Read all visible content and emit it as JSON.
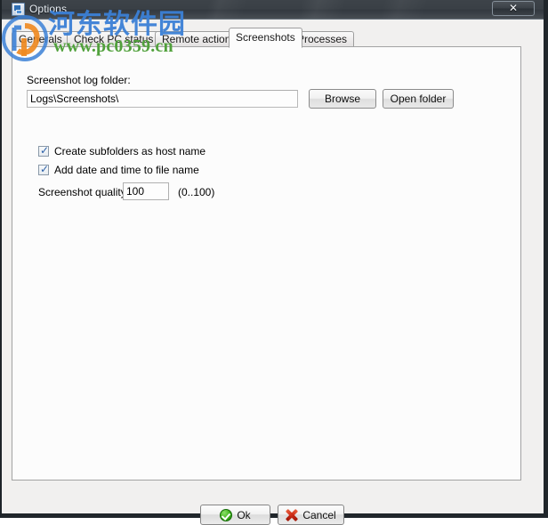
{
  "window": {
    "title": "Options",
    "icon": "application-icon",
    "close_label": "✕"
  },
  "tabs": [
    {
      "label": "Generals",
      "active": false
    },
    {
      "label": "Check PC status",
      "active": false
    },
    {
      "label": "Remote action",
      "active": false
    },
    {
      "label": "Screenshots",
      "active": true
    },
    {
      "label": "Processes",
      "active": false
    }
  ],
  "screenshots_tab": {
    "folder_label": "Screenshot log folder:",
    "folder_value": "Logs\\Screenshots\\",
    "folder_placeholder": "",
    "browse_label": "Browse",
    "open_folder_label": "Open folder",
    "checkbox_subfolders": {
      "label": "Create subfolders as host name",
      "checked": true,
      "mark": "✓"
    },
    "checkbox_datetime": {
      "label": "Add date and time to file name",
      "checked": true,
      "mark": "✓"
    },
    "quality_label": "Screenshot quality",
    "quality_value": "100",
    "quality_range": "(0..100)"
  },
  "footer": {
    "ok_label": "Ok",
    "cancel_label": "Cancel"
  },
  "watermark": {
    "chinese_text": "河东软件园",
    "url_text": "www.pc0359.cn",
    "chinese_color": "#3b80d6",
    "url_color": "#51a13c"
  }
}
